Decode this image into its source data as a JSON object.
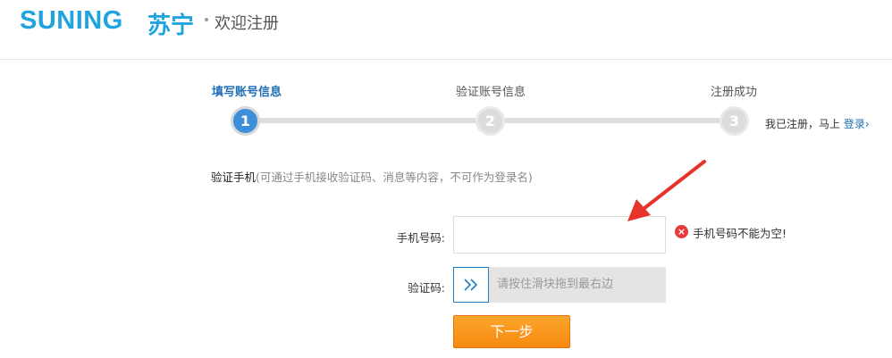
{
  "header": {
    "logo_en": "SUNING",
    "logo_cn": "苏宁",
    "title": "欢迎注册"
  },
  "steps": [
    {
      "label": "填写账号信息",
      "number": "1",
      "active": true
    },
    {
      "label": "验证账号信息",
      "number": "2",
      "active": false
    },
    {
      "label": "注册成功",
      "number": "3",
      "active": false
    }
  ],
  "login_hint": {
    "text": "我已注册，马上",
    "link": "登录",
    "arrow": "›"
  },
  "section": {
    "title": "验证手机",
    "note": "(可通过手机接收验证码、消息等内容，不可作为登录名)"
  },
  "form": {
    "phone_label": "手机号码:",
    "phone_value": "",
    "phone_error": "手机号码不能为空!",
    "error_icon": "×",
    "captcha_label": "验证码:",
    "slider_text": "请按住滑块拖到最右边",
    "next_button": "下一步"
  },
  "colors": {
    "brand": "#1fa4df",
    "active_step": "#3d8fd9",
    "link": "#1f6fb5",
    "button": "#f78a10",
    "error": "#e63a3a",
    "annotation": "#e8332b"
  }
}
